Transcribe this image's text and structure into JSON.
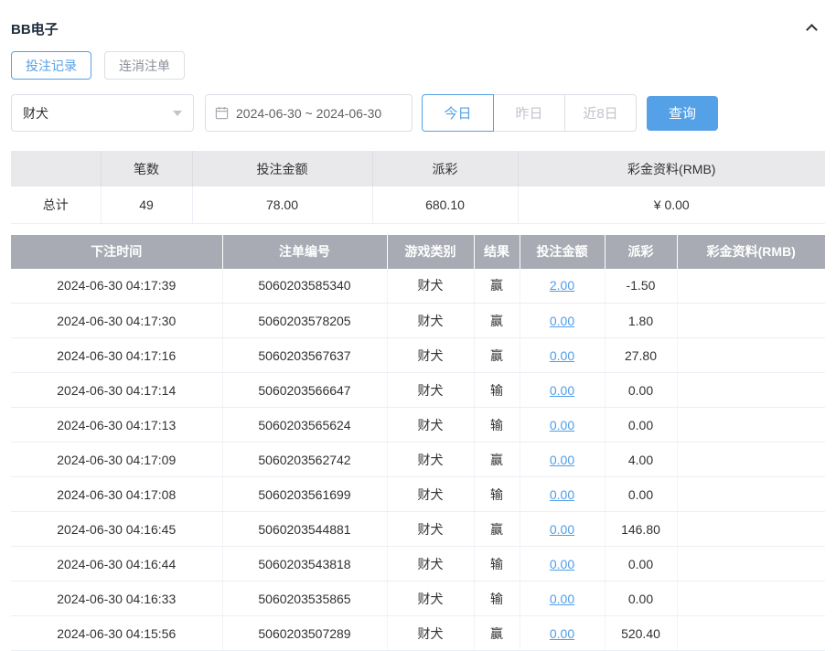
{
  "colors": {
    "accent": "#55a1e8",
    "link": "#4f9de8",
    "negative": "#e25c5c",
    "table_header_bg": "#a8abb3"
  },
  "header": {
    "title": "BB电子"
  },
  "tabs": [
    {
      "label": "投注记录"
    },
    {
      "label": "连消注单"
    }
  ],
  "filters": {
    "game_select_value": "财犬",
    "date_range_value": "2024-06-30 ~ 2024-06-30",
    "quick_ranges": [
      {
        "label": "今日"
      },
      {
        "label": "昨日"
      },
      {
        "label": "近8日"
      }
    ],
    "search_label": "查询"
  },
  "summary": {
    "headers": [
      "笔数",
      "投注金额",
      "派彩",
      "彩金资料(RMB)"
    ],
    "total_label": "总计",
    "count": "49",
    "bet_amount": "78.00",
    "payout": "680.10",
    "bonus": "¥ 0.00"
  },
  "table": {
    "headers": [
      "下注时间",
      "注单编号",
      "游戏类别",
      "结果",
      "投注金额",
      "派彩",
      "彩金资料(RMB)"
    ],
    "rows": [
      {
        "time": "2024-06-30 04:17:39",
        "order": "5060203585340",
        "game": "财犬",
        "result": "赢",
        "amount": "2.00",
        "payout": "-1.50",
        "bonus": ""
      },
      {
        "time": "2024-06-30 04:17:30",
        "order": "5060203578205",
        "game": "财犬",
        "result": "赢",
        "amount": "0.00",
        "payout": "1.80",
        "bonus": ""
      },
      {
        "time": "2024-06-30 04:17:16",
        "order": "5060203567637",
        "game": "财犬",
        "result": "赢",
        "amount": "0.00",
        "payout": "27.80",
        "bonus": ""
      },
      {
        "time": "2024-06-30 04:17:14",
        "order": "5060203566647",
        "game": "财犬",
        "result": "输",
        "amount": "0.00",
        "payout": "0.00",
        "bonus": ""
      },
      {
        "time": "2024-06-30 04:17:13",
        "order": "5060203565624",
        "game": "财犬",
        "result": "输",
        "amount": "0.00",
        "payout": "0.00",
        "bonus": ""
      },
      {
        "time": "2024-06-30 04:17:09",
        "order": "5060203562742",
        "game": "财犬",
        "result": "赢",
        "amount": "0.00",
        "payout": "4.00",
        "bonus": ""
      },
      {
        "time": "2024-06-30 04:17:08",
        "order": "5060203561699",
        "game": "财犬",
        "result": "输",
        "amount": "0.00",
        "payout": "0.00",
        "bonus": ""
      },
      {
        "time": "2024-06-30 04:16:45",
        "order": "5060203544881",
        "game": "财犬",
        "result": "赢",
        "amount": "0.00",
        "payout": "146.80",
        "bonus": ""
      },
      {
        "time": "2024-06-30 04:16:44",
        "order": "5060203543818",
        "game": "财犬",
        "result": "输",
        "amount": "0.00",
        "payout": "0.00",
        "bonus": ""
      },
      {
        "time": "2024-06-30 04:16:33",
        "order": "5060203535865",
        "game": "财犬",
        "result": "输",
        "amount": "0.00",
        "payout": "0.00",
        "bonus": ""
      },
      {
        "time": "2024-06-30 04:15:56",
        "order": "5060203507289",
        "game": "财犬",
        "result": "赢",
        "amount": "0.00",
        "payout": "520.40",
        "bonus": ""
      }
    ]
  }
}
